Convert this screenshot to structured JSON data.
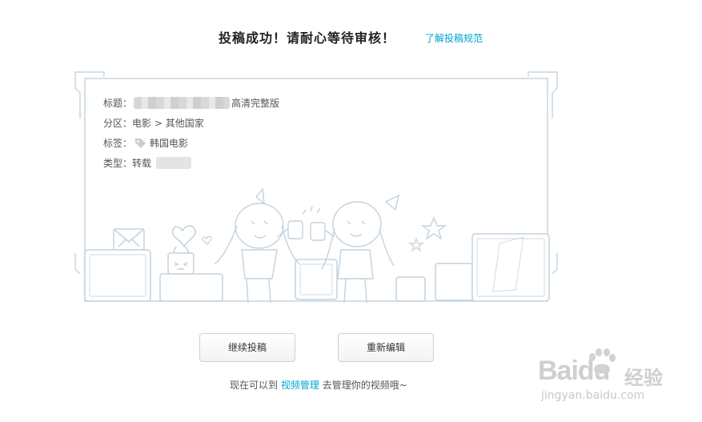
{
  "header": {
    "title": "投稿成功！请耐心等待审核！",
    "rules_link": "了解投稿规范"
  },
  "info": {
    "title_label": "标题：",
    "title_suffix": "高清完整版",
    "category_label": "分区：",
    "category_value": "电影 > 其他国家",
    "tags_label": "标签：",
    "tag_value": "韩国电影",
    "type_label": "类型：",
    "type_value": "转载"
  },
  "buttons": {
    "continue": "继续投稿",
    "edit": "重新编辑"
  },
  "footer": {
    "prefix": "现在可以到",
    "link": "视频管理",
    "suffix": "去管理你的视频哦~"
  },
  "watermark": {
    "brand": "Baidu",
    "cn": "经验",
    "url": "jingyan.baidu.com"
  },
  "colors": {
    "link": "#00a1d6",
    "frame_line": "#c9d6e0"
  },
  "icons": [
    "tag-icon",
    "envelope-icon",
    "heart-icon",
    "tv-mascot-icon",
    "star-icon",
    "paw-icon"
  ]
}
